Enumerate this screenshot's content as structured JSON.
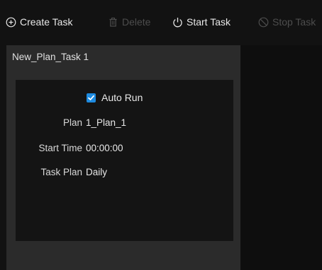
{
  "toolbar": {
    "create_label": "Create Task",
    "delete_label": "Delete",
    "start_label": "Start Task",
    "stop_label": "Stop Task"
  },
  "task": {
    "title": "New_Plan_Task 1",
    "auto_run_label": "Auto Run",
    "auto_run_checked": true,
    "fields": {
      "plan_label": "Plan",
      "plan_value": "1_Plan_1",
      "start_time_label": "Start Time",
      "start_time_value": "00:00:00",
      "task_plan_label": "Task Plan",
      "task_plan_value": "Daily"
    }
  },
  "colors": {
    "accent": "#1e8be0",
    "background": "#121212",
    "panel": "#2b2b2b",
    "card": "#141414",
    "disabled_text": "#4d4d4d"
  },
  "icons": {
    "create": "plus-circle-icon",
    "delete": "trash-icon",
    "start": "power-icon",
    "stop": "stop-circle-icon",
    "checkbox": "checkmark-icon"
  }
}
